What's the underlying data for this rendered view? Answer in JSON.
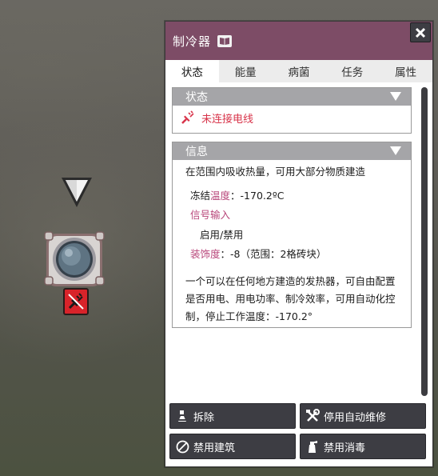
{
  "building": {
    "title": "制冷器"
  },
  "tabs": [
    {
      "label": "状态",
      "active": true
    },
    {
      "label": "能量",
      "active": false
    },
    {
      "label": "病菌",
      "active": false
    },
    {
      "label": "任务",
      "active": false
    },
    {
      "label": "属性",
      "active": false
    }
  ],
  "status_section": {
    "title": "状态",
    "status_text": "未连接电线",
    "status_icon": "unplugged-icon"
  },
  "info_section": {
    "title": "信息",
    "summary": "在范围内吸收热量，可用大部分物质建造",
    "freeze_label": "冻结",
    "temperature_label": "温度",
    "freeze_value": "：-170.2ºC",
    "signal_input_label": "信号输入",
    "signal_value": "启用/禁用",
    "decor_label": "装饰度",
    "decor_value": "：-8（范围：2格砖块）",
    "description": "一个可以在任何地方建造的发热器，可自由配置是否用电、用电功率、制冷效率，可用自动化控制，停止工作温度：-170.2°"
  },
  "buttons": {
    "deconstruct": "拆除",
    "disable_auto_repair": "停用自动维修",
    "disable_building": "禁用建筑",
    "disable_disinfect": "禁用消毒"
  },
  "colors": {
    "header": "#7d4c66",
    "status_warning": "#d8344a",
    "highlight": "#b8467a",
    "button_bg": "#3d3d43"
  }
}
